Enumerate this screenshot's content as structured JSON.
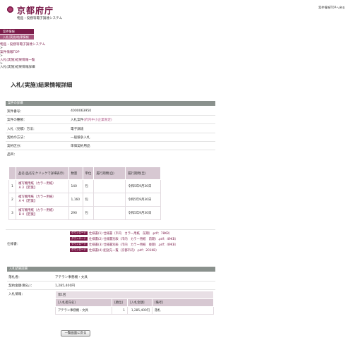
{
  "header": {
    "logo_text": "京都府庁",
    "subtitle": "物品・役務等電子調達システム",
    "top_link": "案件情報TOPへ戻る"
  },
  "nav": {
    "main": "案件情報",
    "sub": "入札(実施)結果情報"
  },
  "breadcrumb": [
    "物品・役務等電子調達システム",
    ">",
    "案件情報TOP",
    ">",
    "入札(実施)結果情報一覧",
    ">",
    "入札(実施)結果情報詳細"
  ],
  "page_title": "入札(実施)結果情報詳細",
  "details": {
    "section_title": "案件の詳細",
    "rows": [
      {
        "label": "案件番号：",
        "value": "4000063950"
      },
      {
        "label": "案件の種類：",
        "value": "入札案件",
        "tag": "(府内中小企業限定)"
      },
      {
        "label": "入札（見積）方法：",
        "value": "電子調達"
      },
      {
        "label": "契約の方法：",
        "value": "一般競争入札"
      },
      {
        "label": "契約区分：",
        "value": "単価契約用品"
      },
      {
        "label": "品目：",
        "value": ""
      }
    ]
  },
  "items_table": {
    "headers": [
      "",
      "品名(品名をクリックで詳細表示)",
      "数量",
      "単位",
      "履行期間(自)",
      "履行期間(至)"
    ],
    "rows": [
      {
        "no": "1",
        "name_line1": "複写機用紙（カラー用紙）",
        "name_line2": "Ａ３【若葉】",
        "qty": "140",
        "unit": "包",
        "from": "",
        "to": "令和5年9月30日"
      },
      {
        "no": "2",
        "name_line1": "複写機用紙（カラー用紙）",
        "name_line2": "Ａ４【若葉】",
        "qty": "1,160",
        "unit": "包",
        "from": "",
        "to": "令和5年9月30日"
      },
      {
        "no": "3",
        "name_line1": "複写機用紙（カラー用紙）",
        "name_line2": "Ｂ４【若葉】",
        "qty": "290",
        "unit": "包",
        "from": "",
        "to": "令和5年9月30日"
      }
    ]
  },
  "spec": {
    "label": "仕様書：",
    "badge": "ダウンロード",
    "files": [
      "仕様書(1) 仕様書（市内　カラー用紙　前期）.pdf：78KB）",
      "仕様書(2) 仕様書別表（市内　カラー用紙　前期）.pdf：49KB）",
      "仕様書(3) 仕様書別表（市内　カラー用紙　後期）.pdf：49KB）",
      "仕様書(4) 配送先一覧（京都市内）.pdf：201KB）"
    ]
  },
  "result": {
    "section_title": "入札結果詳細",
    "winner_label": "落札者：",
    "winner": "アテラン事務機・文具",
    "amount_label": "契約金額(税込)：",
    "amount": "1,285,400円",
    "info_label": "入札情報：",
    "round": "第1回",
    "bid_headers": [
      "[入札者氏名]",
      "[順位]",
      "[入札金額]",
      "[備考]"
    ],
    "bid_row": [
      "アテラン事務機・文具",
      "1",
      "1,285,400円",
      "落札"
    ]
  },
  "back_button": "一覧画面に戻る",
  "colors": {
    "brand": "#7b1c4a",
    "section": "#8a918d",
    "table_header": "#d7c8d2"
  }
}
